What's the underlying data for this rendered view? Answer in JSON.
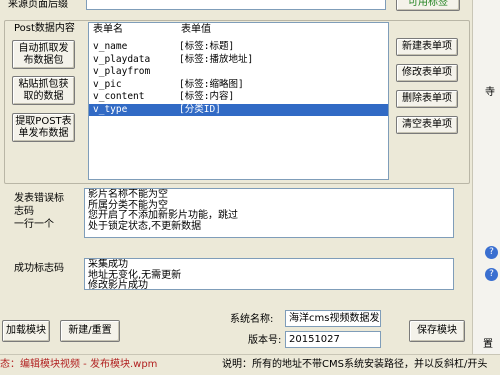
{
  "top": {
    "source_label": "来源页面后缀",
    "available_tags_button": "可用标签"
  },
  "post": {
    "group_label": "Post数据内容",
    "buttons": {
      "auto_capture": "自动抓取发\n布数据包",
      "paste_capture": "粘贴抓包获\n取的数据",
      "extract_post": "提取POST表\n单发布数据"
    },
    "table": {
      "headers": [
        "表单名",
        "表单值"
      ],
      "rows": [
        {
          "name": "v_name",
          "value": "[标签:标题]"
        },
        {
          "name": "v_playdata",
          "value": "[标签:播放地址]"
        },
        {
          "name": "v_playfrom",
          "value": ""
        },
        {
          "name": "v_pic",
          "value": "[标签:缩略图]"
        },
        {
          "name": "v_content",
          "value": "[标签:内容]"
        },
        {
          "name": "v_type",
          "value": "[分类ID]"
        }
      ],
      "selected_index": 5
    },
    "actions": {
      "new_item": "新建表单项",
      "edit_item": "修改表单项",
      "delete_item": "删除表单项",
      "clear_items": "清空表单项"
    }
  },
  "error": {
    "label": "发表错误标\n志码\n一行一个",
    "text": "影片名称不能为空\n所属分类不能为空\n您开启了不添加新影片功能，跳过\n处于锁定状态,不更新数据"
  },
  "success": {
    "label": "成功标志码",
    "text": "采集成功\n地址无变化,无需更新\n修改影片成功"
  },
  "bottom": {
    "load_module": "加载模块",
    "new_reset": "新建/重置",
    "system_name_label": "系统名称:",
    "system_name_value": "海洋cms视频数据发布",
    "version_label": "版本号:",
    "version_value": "20151027",
    "save_module": "保存模块"
  },
  "status": {
    "left": "态：编辑模块视频 - 发布模块.wpm",
    "right": "说明：所有的地址不带CMS系统安装路径，并以反斜杠/开头"
  },
  "right_edge": {
    "fragment_1": "寺",
    "fragment_2": "置"
  },
  "colors": {
    "selection": "#316ac5",
    "status_left_text": "#b22222"
  }
}
